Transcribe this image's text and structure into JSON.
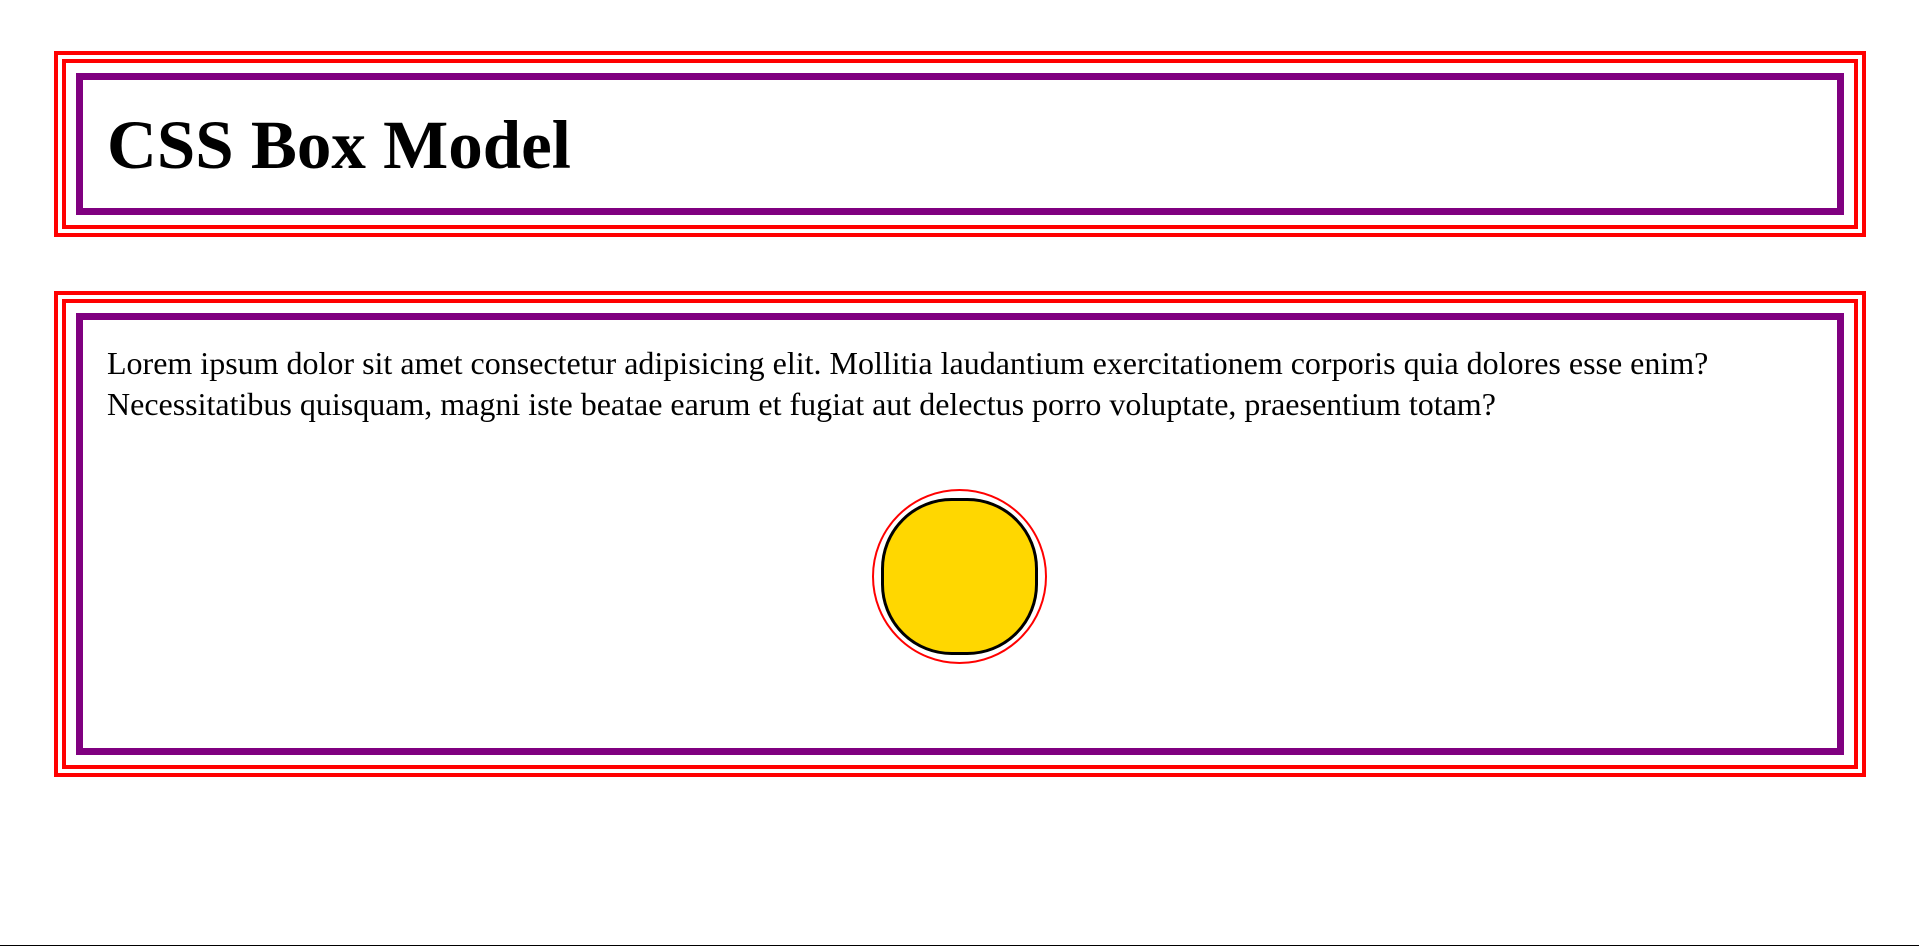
{
  "header": {
    "title": "CSS Box Model"
  },
  "main": {
    "paragraph": "Lorem ipsum dolor sit amet consectetur adipisicing elit. Mollitia laudantium exercitationem corporis quia dolores esse enim? Necessitatibus quisquam, magni iste beatae earum et fugiat aut delectus porro voluptate, praesentium totam?"
  },
  "colors": {
    "outer_border": "#ff0000",
    "inner_border": "#800080",
    "circle_fill": "#ffd700",
    "circle_border": "#000000"
  }
}
